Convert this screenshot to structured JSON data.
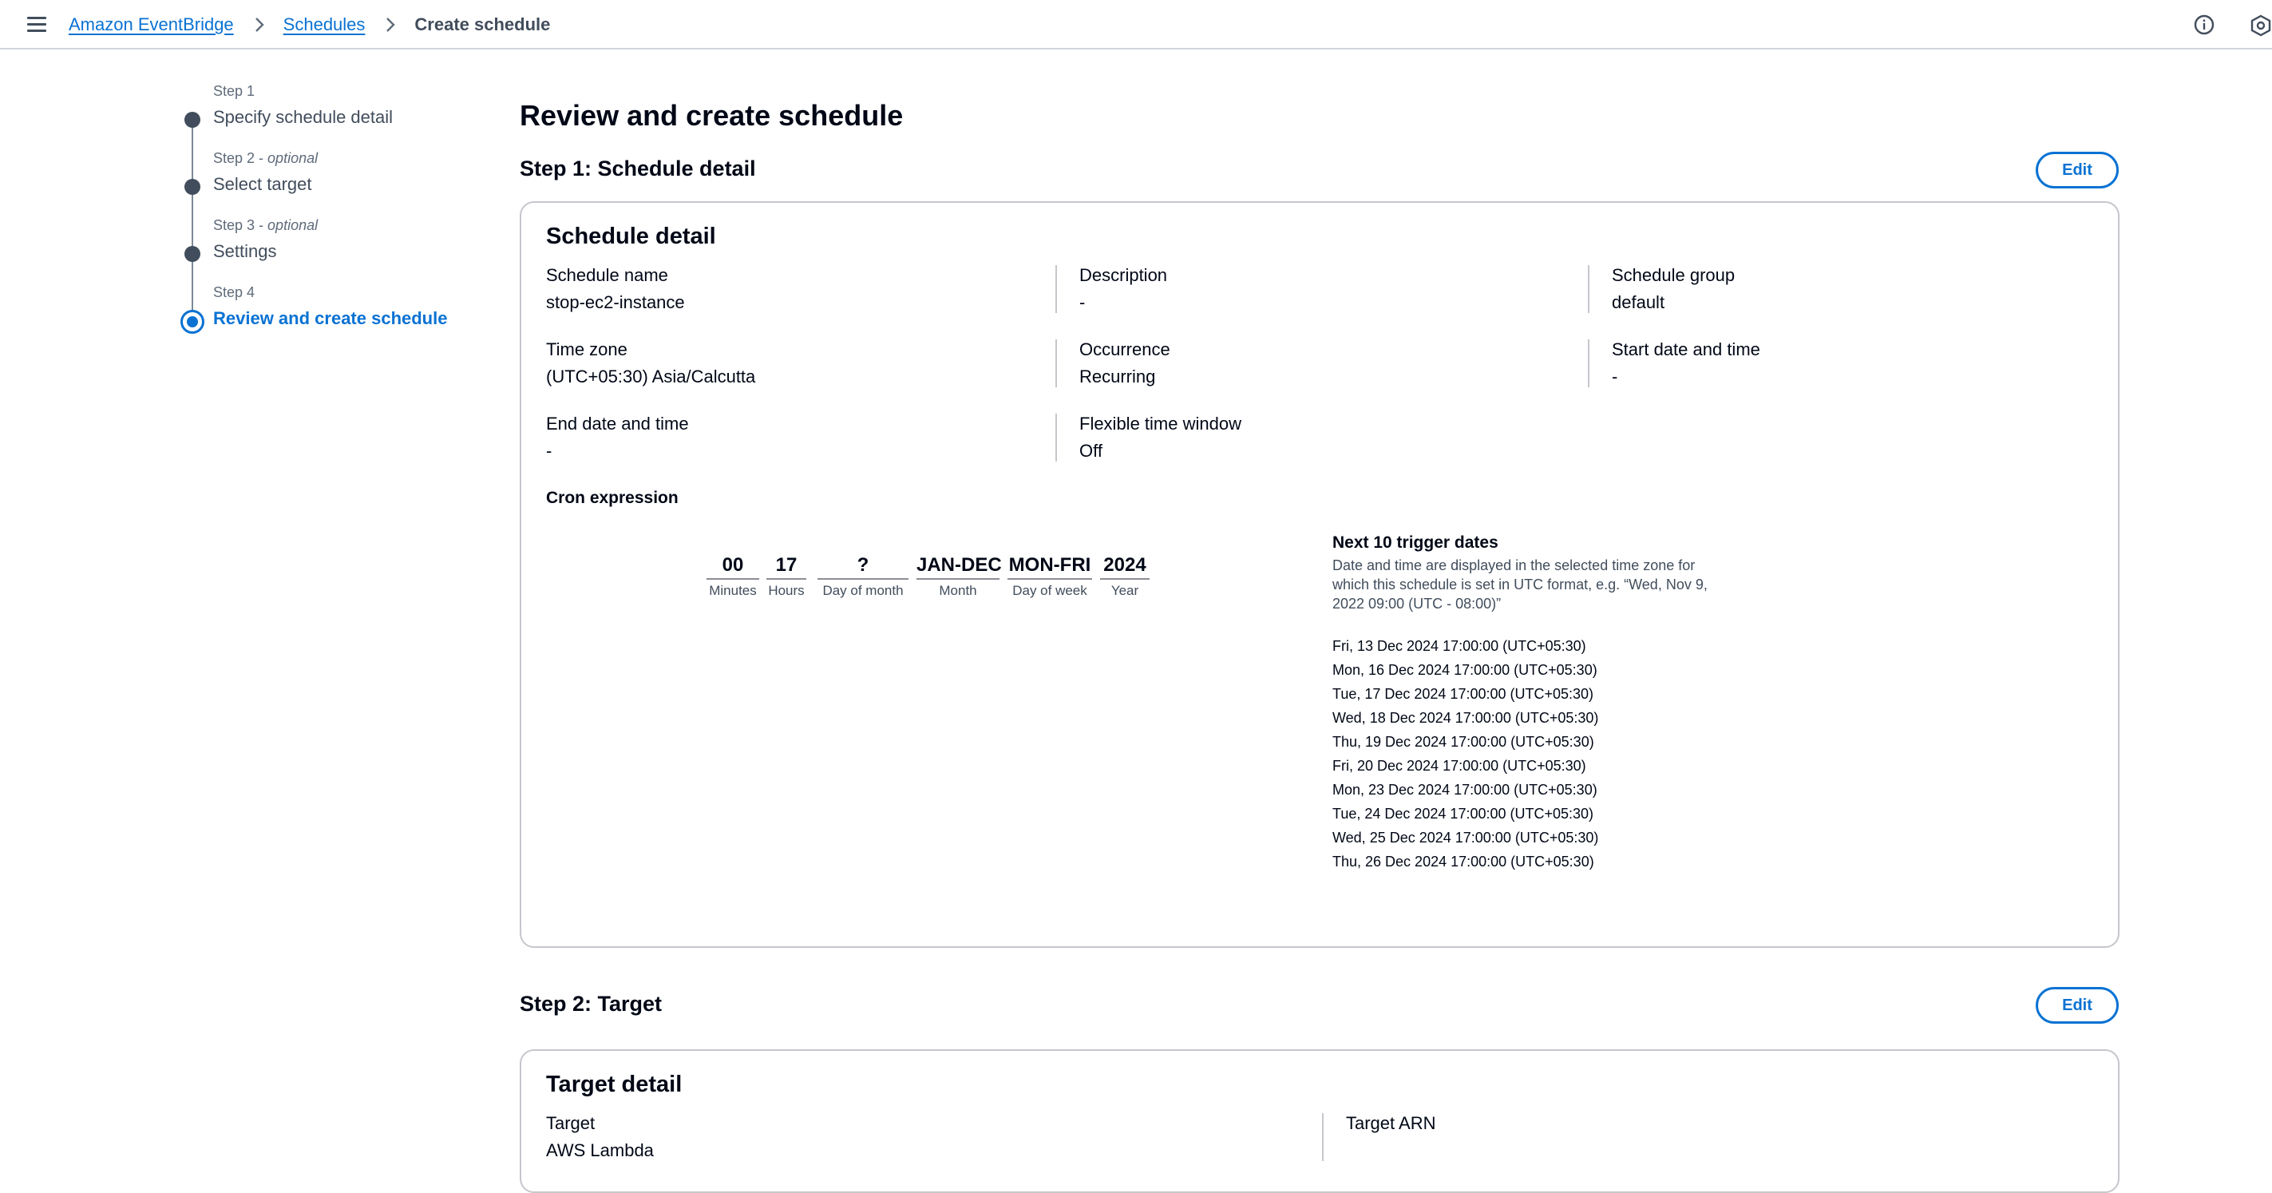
{
  "header": {
    "breadcrumbs": [
      {
        "label": "Amazon EventBridge"
      },
      {
        "label": "Schedules"
      },
      {
        "label": "Create schedule"
      }
    ]
  },
  "steps": [
    {
      "num": "Step 1",
      "optional": "",
      "title": "Specify schedule detail"
    },
    {
      "num": "Step 2",
      "optional": "optional",
      "title": "Select target"
    },
    {
      "num": "Step 3",
      "optional": "optional",
      "title": "Settings"
    },
    {
      "num": "Step 4",
      "optional": "",
      "title": "Review and create schedule"
    }
  ],
  "main": {
    "page_title": "Review and create schedule",
    "step1": {
      "heading": "Step 1: Schedule detail",
      "edit_label": "Edit",
      "card_title": "Schedule detail",
      "fields": {
        "schedule_name": {
          "label": "Schedule name",
          "value": "stop-ec2-instance"
        },
        "description": {
          "label": "Description",
          "value": "-"
        },
        "schedule_group": {
          "label": "Schedule group",
          "value": "default"
        },
        "time_zone": {
          "label": "Time zone",
          "value": "(UTC+05:30) Asia/Calcutta"
        },
        "occurrence": {
          "label": "Occurrence",
          "value": "Recurring"
        },
        "start": {
          "label": "Start date and time",
          "value": "-"
        },
        "end": {
          "label": "End date and time",
          "value": "-"
        },
        "flex": {
          "label": "Flexible time window",
          "value": "Off"
        }
      },
      "cron": {
        "label": "Cron expression",
        "fields": [
          {
            "value": "00",
            "name": "Minutes"
          },
          {
            "value": "17",
            "name": "Hours"
          },
          {
            "value": "?",
            "name": "Day of month"
          },
          {
            "value": "JAN-DEC",
            "name": "Month"
          },
          {
            "value": "MON-FRI",
            "name": "Day of week"
          },
          {
            "value": "2024",
            "name": "Year"
          }
        ]
      },
      "triggers": {
        "title": "Next 10 trigger dates",
        "description": "Date and time are displayed in the selected time zone for which this schedule is set in UTC format, e.g. “Wed, Nov 9, 2022 09:00 (UTC - 08:00)”",
        "dates": [
          "Fri, 13 Dec 2024 17:00:00 (UTC+05:30)",
          "Mon, 16 Dec 2024 17:00:00 (UTC+05:30)",
          "Tue, 17 Dec 2024 17:00:00 (UTC+05:30)",
          "Wed, 18 Dec 2024 17:00:00 (UTC+05:30)",
          "Thu, 19 Dec 2024 17:00:00 (UTC+05:30)",
          "Fri, 20 Dec 2024 17:00:00 (UTC+05:30)",
          "Mon, 23 Dec 2024 17:00:00 (UTC+05:30)",
          "Tue, 24 Dec 2024 17:00:00 (UTC+05:30)",
          "Wed, 25 Dec 2024 17:00:00 (UTC+05:30)",
          "Thu, 26 Dec 2024 17:00:00 (UTC+05:30)"
        ]
      }
    },
    "step2": {
      "heading": "Step 2: Target",
      "edit_label": "Edit",
      "card_title": "Target detail",
      "target_label": "Target",
      "target_value": "AWS Lambda",
      "arn_label": "Target ARN"
    }
  },
  "icons": {
    "menu": "hamburger-menu-icon",
    "separator": "chevron-right-icon",
    "info": "info-icon",
    "settings": "hexagon-icon"
  },
  "colors": {
    "accent": "#0972d3",
    "text": "#000716",
    "muted": "#414d5c",
    "border": "#c6c6cd"
  }
}
